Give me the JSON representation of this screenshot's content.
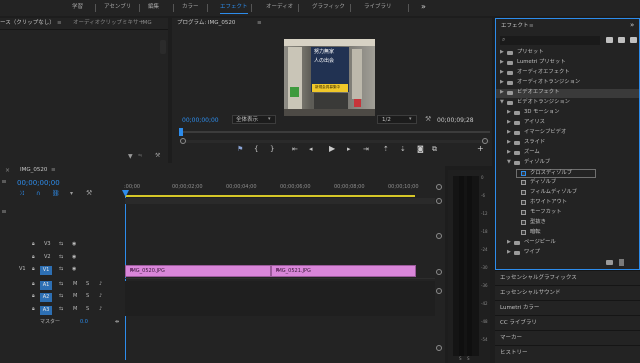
{
  "workspaces": [
    "学習",
    "アセンブリ",
    "編集",
    "カラー",
    "エフェクト",
    "オーディオ",
    "グラフィック",
    "ライブラリ"
  ],
  "workspace_active": "エフェクト",
  "workspace_more_icon": "double-chevron-right-icon",
  "source": {
    "tab_label": "ース（クリップなし）",
    "menu_icon": "≡",
    "mixer_tab": "オーディオクリップミキサー",
    "mixer_suffix": "IMG"
  },
  "program": {
    "title": "プログラム: IMG_0520",
    "timecode": "00;00;00;00",
    "fit_label": "全体表示",
    "resolution": "1/2",
    "duration": "00;00;09;28",
    "preview_text_top": "努力無家",
    "preview_text_mid": "人の出会",
    "preview_sign": "新規会員募集中"
  },
  "effects": {
    "title": "エフェクト",
    "search_placeholder": "",
    "tree": [
      {
        "label": "プリセット",
        "type": "folder",
        "level": 0,
        "expanded": false
      },
      {
        "label": "Lumetri プリセット",
        "type": "folder",
        "level": 0,
        "expanded": false
      },
      {
        "label": "オーディオエフェクト",
        "type": "folder",
        "level": 0,
        "expanded": false
      },
      {
        "label": "オーディオトランジション",
        "type": "folder",
        "level": 0,
        "expanded": false
      },
      {
        "label": "ビデオエフェクト",
        "type": "folder",
        "level": 0,
        "expanded": false,
        "highlighted": true
      },
      {
        "label": "ビデオトランジション",
        "type": "folder",
        "level": 0,
        "expanded": true
      },
      {
        "label": "3D モーション",
        "type": "folder",
        "level": 1,
        "expanded": false
      },
      {
        "label": "アイリス",
        "type": "folder",
        "level": 1,
        "expanded": false
      },
      {
        "label": "イマーシブビデオ",
        "type": "folder",
        "level": 1,
        "expanded": false
      },
      {
        "label": "スライド",
        "type": "folder",
        "level": 1,
        "expanded": false
      },
      {
        "label": "ズーム",
        "type": "folder",
        "level": 1,
        "expanded": false
      },
      {
        "label": "ディゾルブ",
        "type": "folder",
        "level": 1,
        "expanded": true
      },
      {
        "label": "クロスディゾルブ",
        "type": "fx",
        "level": 2,
        "selected": true
      },
      {
        "label": "ディゾルブ",
        "type": "fx",
        "level": 2
      },
      {
        "label": "フィルムディゾルブ",
        "type": "fx",
        "level": 2
      },
      {
        "label": "ホワイトアウト",
        "type": "fx",
        "level": 2
      },
      {
        "label": "モーフカット",
        "type": "fx",
        "level": 2
      },
      {
        "label": "型抜き",
        "type": "fx",
        "level": 2
      },
      {
        "label": "暗転",
        "type": "fx",
        "level": 2
      },
      {
        "label": "ページピール",
        "type": "folder",
        "level": 1,
        "expanded": false
      },
      {
        "label": "ワイプ",
        "type": "folder",
        "level": 1,
        "expanded": false
      }
    ],
    "lower_panels": [
      "エッセンシャルグラフィックス",
      "エッセンシャルサウンド",
      "Lumetri カラー",
      "CC ライブラリ",
      "マーカー",
      "ヒストリー"
    ]
  },
  "timeline": {
    "tab_label": "IMG_0520",
    "menu_icon": "≡",
    "timecode": "00;00;00;00",
    "ruler": [
      ":00;00",
      "00;00;02;00",
      "00;00;04;00",
      "00;00;06;00",
      "00;00;08;00",
      "00;00;10;00"
    ],
    "tracks_video": [
      "V3",
      "V2",
      "V1"
    ],
    "tracks_audio": [
      "A1",
      "A2",
      "A3"
    ],
    "source_patch": "V1",
    "master_label": "マスター",
    "master_value": "0.0",
    "clips": [
      "IMG_0520.JPG",
      "IMG_0521.JPG"
    ]
  },
  "meter": {
    "labels": [
      "S",
      "S"
    ],
    "scale": [
      "0",
      "-6",
      "-12",
      "-18",
      "-24",
      "-30",
      "-36",
      "-42",
      "-48",
      "-54"
    ]
  }
}
